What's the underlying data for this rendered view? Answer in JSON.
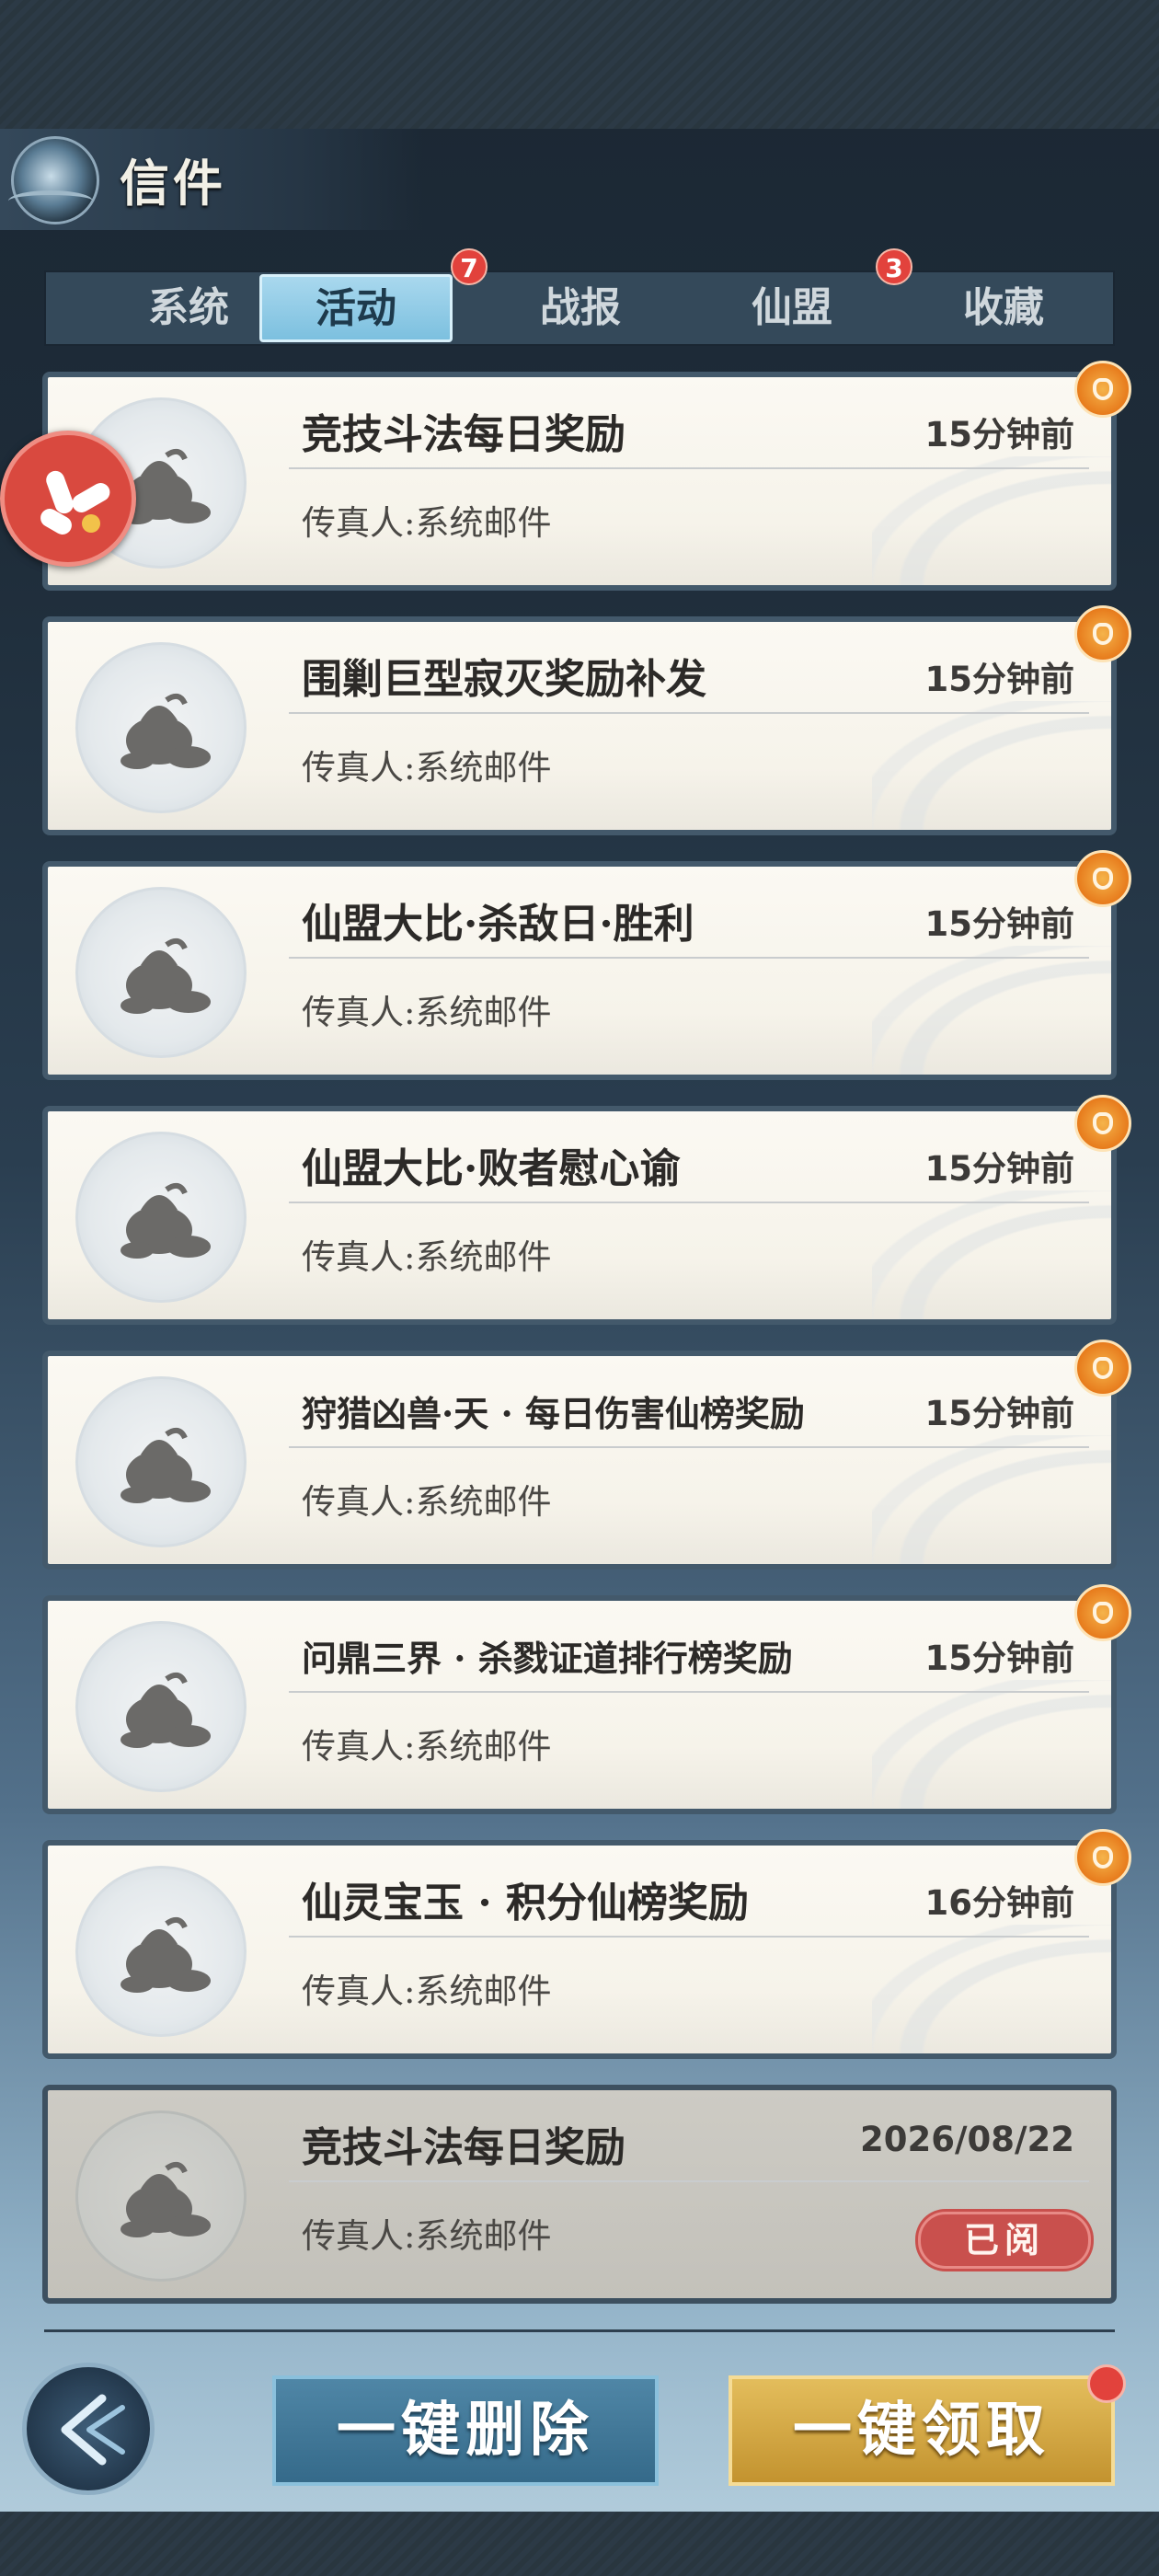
{
  "header": {
    "title": "信件"
  },
  "tabs": [
    {
      "label": "系统",
      "badge": ""
    },
    {
      "label": "活动",
      "badge": "7",
      "active": true
    },
    {
      "label": "战报",
      "badge": ""
    },
    {
      "label": "仙盟",
      "badge": "3"
    },
    {
      "label": "收藏",
      "badge": ""
    }
  ],
  "mails": [
    {
      "subject": "竞技斗法每日奖励",
      "time": "15分钟前",
      "sender": "传真人:系统邮件",
      "read": false,
      "has_gift": true
    },
    {
      "subject": "围剿巨型寂灭奖励补发",
      "time": "15分钟前",
      "sender": "传真人:系统邮件",
      "read": false,
      "has_gift": true
    },
    {
      "subject": "仙盟大比·杀敌日·胜利",
      "time": "15分钟前",
      "sender": "传真人:系统邮件",
      "read": false,
      "has_gift": true
    },
    {
      "subject": "仙盟大比·败者慰心谕",
      "time": "15分钟前",
      "sender": "传真人:系统邮件",
      "read": false,
      "has_gift": true
    },
    {
      "subject": "狩猎凶兽·天 · 每日伤害仙榜奖励",
      "time": "15分钟前",
      "sender": "传真人:系统邮件",
      "read": false,
      "has_gift": true
    },
    {
      "subject": "问鼎三界 · 杀戮证道排行榜奖励",
      "time": "15分钟前",
      "sender": "传真人:系统邮件",
      "read": false,
      "has_gift": true
    },
    {
      "subject": "仙灵宝玉 · 积分仙榜奖励",
      "time": "16分钟前",
      "sender": "传真人:系统邮件",
      "read": false,
      "has_gift": true
    },
    {
      "subject": "竞技斗法每日奖励",
      "time": "2026/08/22",
      "sender": "传真人:系统邮件",
      "read": true,
      "has_gift": false,
      "read_label": "已阅"
    }
  ],
  "footer": {
    "delete_all_label": "一键删除",
    "claim_all_label": "一键领取"
  },
  "icons": {
    "back": "back-arrow-icon",
    "gift": "gift-bag-icon",
    "mail_avatar": "treasure-bag-icon",
    "floating": "assistant-bubble-icon"
  },
  "colors": {
    "active_tab": "#7cc0df",
    "badge_red": "#e2423c",
    "gift_orange": "#e77b1c",
    "read_stamp": "#c9504d",
    "delete_button": "#356a8a",
    "claim_button": "#c3932f"
  }
}
